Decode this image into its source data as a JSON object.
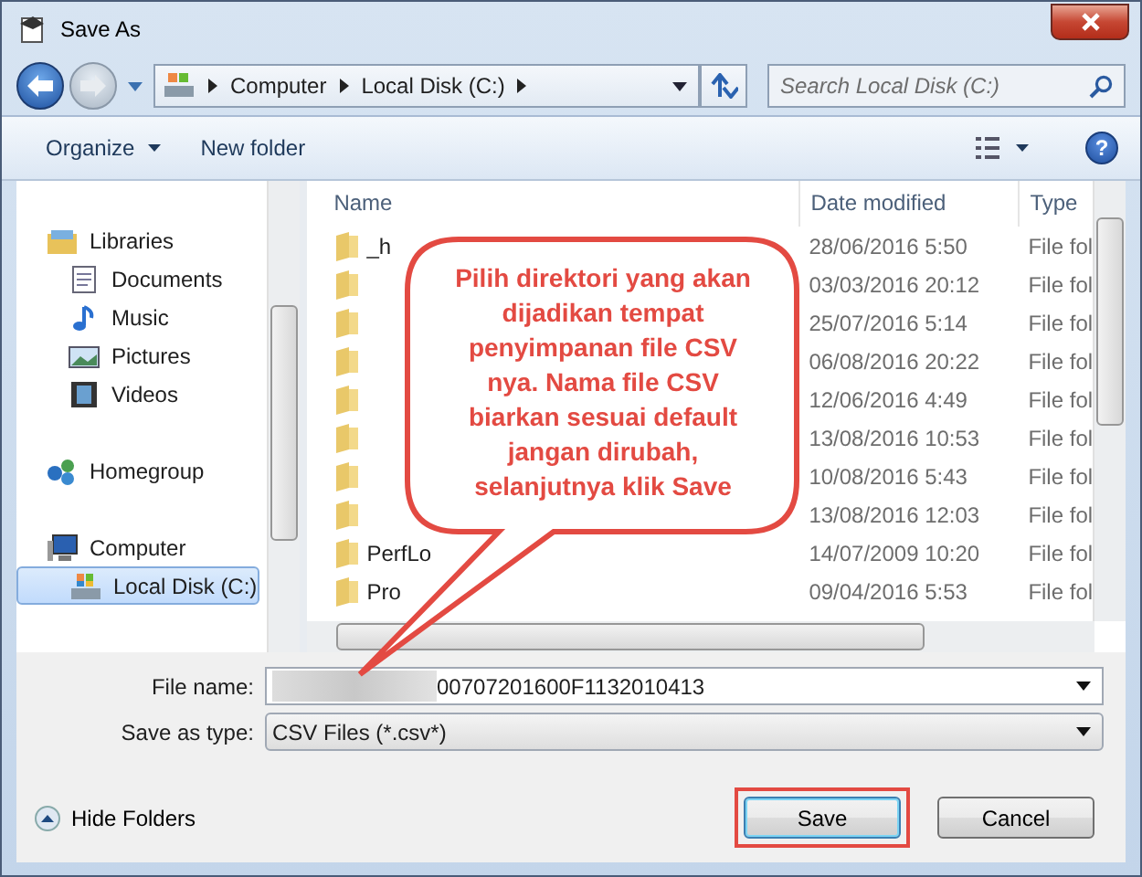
{
  "window": {
    "title": "Save As"
  },
  "address": {
    "crumbs": [
      "Computer",
      "Local Disk (C:)"
    ]
  },
  "search": {
    "placeholder": "Search Local Disk (C:)"
  },
  "toolbar": [
    {
      "label": "Organize",
      "dropdown": true
    },
    {
      "label": "New folder",
      "dropdown": false
    }
  ],
  "help": "?",
  "nav": [
    {
      "label": "Libraries",
      "kind": "library",
      "selected": false,
      "children": [
        {
          "label": "Documents",
          "kind": "document",
          "selected": false
        },
        {
          "label": "Music",
          "kind": "music",
          "selected": false
        },
        {
          "label": "Pictures",
          "kind": "picture",
          "selected": false
        },
        {
          "label": "Videos",
          "kind": "video",
          "selected": false
        }
      ]
    },
    {
      "label": "Homegroup",
      "kind": "homegroup",
      "selected": false
    },
    {
      "label": "Computer",
      "kind": "computer",
      "selected": false,
      "children": [
        {
          "label": "Local Disk (C:)",
          "kind": "disk",
          "selected": true
        }
      ]
    }
  ],
  "columns": [
    "Name",
    "Date modified",
    "Type"
  ],
  "rows": [
    {
      "name": "_h",
      "date": "28/06/2016 5:50",
      "type": "File fol"
    },
    {
      "date": "03/03/2016 20:12",
      "type": "File fol"
    },
    {
      "date": "25/07/2016 5:14",
      "type": "File fol"
    },
    {
      "date": "06/08/2016 20:22",
      "type": "File fol"
    },
    {
      "date": "12/06/2016 4:49",
      "type": "File fol"
    },
    {
      "date": "13/08/2016 10:53",
      "type": "File fol"
    },
    {
      "date": "10/08/2016 5:43",
      "type": "File fol"
    },
    {
      "date": "13/08/2016 12:03",
      "type": "File fol"
    },
    {
      "name": "PerfLo",
      "date": "14/07/2009 10:20",
      "type": "File fol"
    },
    {
      "name": "Pro",
      "date": "09/04/2016 5:53",
      "type": "File fol"
    }
  ],
  "file_name": {
    "label": "File name:",
    "value": "00707201600F1132010413"
  },
  "save_type": {
    "label": "Save as type:",
    "value": "CSV Files (*.csv*)"
  },
  "hide_folders": "Hide Folders",
  "buttons": [
    {
      "label": "Save",
      "highlighted": true
    },
    {
      "label": "Cancel",
      "highlighted": false
    }
  ],
  "callout": {
    "text": "Pilih direktori yang akan dijadikan tempat penyimpanan file CSV nya. Nama file CSV biarkan sesuai default jangan dirubah, selanjutnya klik Save"
  }
}
